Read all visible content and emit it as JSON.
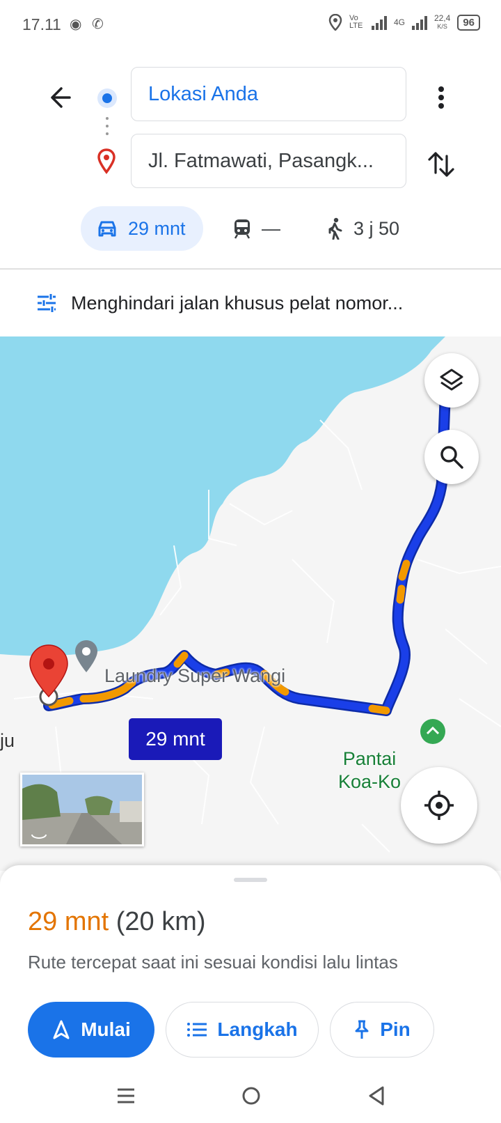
{
  "status_bar": {
    "time": "17.11",
    "network_label": "Vo LTE",
    "network_type": "4G",
    "speed": "22,4",
    "speed_unit": "K/S",
    "battery": "96"
  },
  "directions": {
    "origin": "Lokasi Anda",
    "destination": "Jl. Fatmawati, Pasangk...",
    "modes": {
      "car": "29 mnt",
      "transit": "—",
      "walk": "3 j 50"
    },
    "options_text": "Menghindari jalan khusus pelat nomor..."
  },
  "map": {
    "place_laundry": "Laundry Super Wangi",
    "place_pantai_line1": "Pantai",
    "place_pantai_line2": "Koa-Ko",
    "edge_label": "ju",
    "eta_bubble": "29 mnt",
    "route_color": "#1a3fe8",
    "traffic_color": "#f29900",
    "water_color": "#8fd9ee"
  },
  "sheet": {
    "duration": "29 mnt",
    "distance": "(20 km)",
    "description": "Rute tercepat saat ini sesuai kondisi lalu lintas",
    "start_label": "Mulai",
    "steps_label": "Langkah",
    "pin_label": "Pin"
  },
  "colors": {
    "accent": "#1a73e8",
    "duration": "#e37400"
  }
}
